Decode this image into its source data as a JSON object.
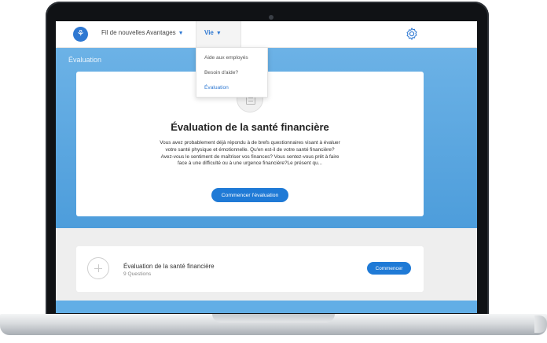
{
  "nav": {
    "feed": "Fil de nouvelles",
    "benefits": "Avantages",
    "life": "Vie"
  },
  "dropdown": {
    "items": [
      "Aide aux employés",
      "Besoin d'aide?",
      "Évaluation"
    ]
  },
  "hero": {
    "title": "Évaluation"
  },
  "card": {
    "title": "Évaluation de la santé financière",
    "description": "Vous avez probablement déjà répondu à de brefs questionnaires visant à évaluer votre santé physique et émotionnelle. Qu'en est-il de votre santé financière? Avez-vous le sentiment de maîtriser vos finances? Vous sentez-vous prêt à faire face à une difficulté ou à une urgence financière?Le présent qu...",
    "button": "Commencer l'évaluation"
  },
  "assessment": {
    "title": "Évaluation de la santé financière",
    "questions": "9 Questions",
    "button": "Commencer"
  },
  "colors": {
    "accent": "#1f7ad6",
    "hero": "#5aa7e0"
  },
  "icons": {
    "logo": "brand-logo",
    "settings": "gear-icon",
    "chevron": "chevron-down-icon",
    "card": "document-icon",
    "add": "plus-circle-icon"
  }
}
